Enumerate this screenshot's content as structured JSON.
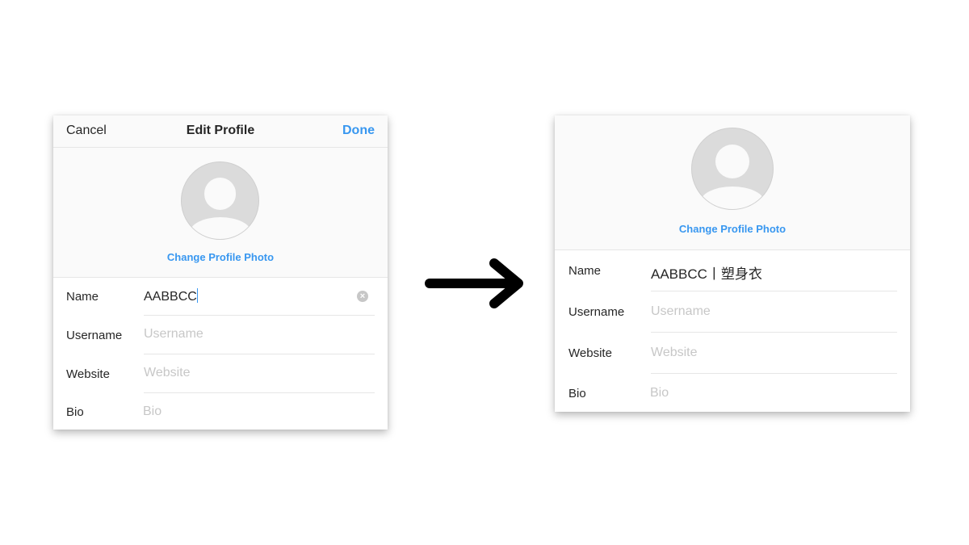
{
  "left_screen": {
    "nav": {
      "cancel_label": "Cancel",
      "title": "Edit Profile",
      "done_label": "Done"
    },
    "change_photo_label": "Change Profile Photo",
    "fields": [
      {
        "label": "Name",
        "value": "AABBCC",
        "placeholder": ""
      },
      {
        "label": "Username",
        "value": "",
        "placeholder": "Username"
      },
      {
        "label": "Website",
        "value": "",
        "placeholder": "Website"
      },
      {
        "label": "Bio",
        "value": "",
        "placeholder": "Bio"
      }
    ]
  },
  "right_screen": {
    "change_photo_label": "Change Profile Photo",
    "fields": [
      {
        "label": "Name",
        "value": "AABBCC丨塑身衣",
        "placeholder": ""
      },
      {
        "label": "Username",
        "value": "",
        "placeholder": "Username"
      },
      {
        "label": "Website",
        "value": "",
        "placeholder": "Website"
      },
      {
        "label": "Bio",
        "value": "",
        "placeholder": "Bio"
      }
    ]
  },
  "colors": {
    "accent": "#3897f0",
    "text": "#262626",
    "placeholder": "#c7c7c7",
    "divider": "#e6e6e6",
    "panel": "#fafafa"
  },
  "icons": {
    "clear": "clear-circle-icon",
    "arrow": "right-arrow-icon",
    "avatar": "default-avatar-icon"
  }
}
